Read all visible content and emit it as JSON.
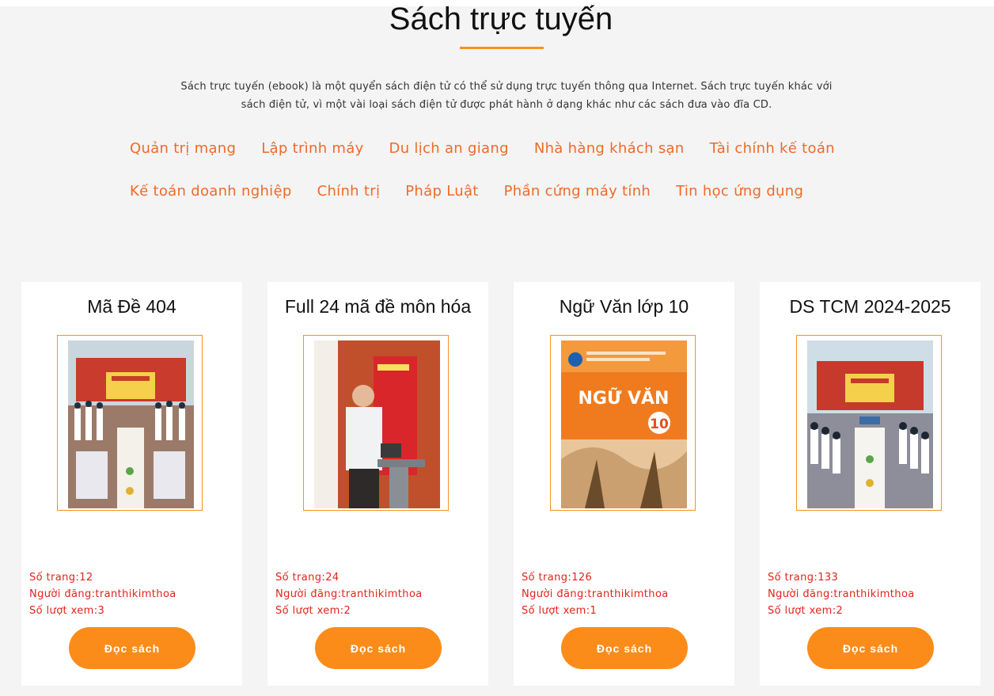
{
  "page": {
    "title": "Sách trực tuyến",
    "intro_line1": "Sách trực tuyến (ebook) là một quyển sách điện tử có thể sử dụng trực tuyến thông qua Internet. Sách trực tuyến khác với",
    "intro_line2": "sách điện tử, vì một vài loại sách điện tử được phát hành ở dạng khác như các sách đưa vào đĩa CD."
  },
  "categories_row1": [
    "Quản trị mạng",
    "Lập trình máy",
    "Du lịch an giang",
    "Nhà hàng khách sạn",
    "Tài chính kế toán"
  ],
  "categories_row2": [
    "Kế toán doanh nghiệp",
    "Chính trị",
    "Pháp Luật",
    "Phần cứng máy tính",
    "Tin học ứng dụng"
  ],
  "books": [
    {
      "title": "Mã Đề 404",
      "pages": "Số trang:12",
      "poster": "Người đăng:tranthikimthoa",
      "views": "Số lượt xem:3",
      "button": "Đọc sách"
    },
    {
      "title": "Full 24 mã đề môn hóa",
      "pages": "Số trang:24",
      "poster": "Người đăng:tranthikimthoa",
      "views": "Số lượt xem:2",
      "button": "Đọc sách"
    },
    {
      "title": "Ngữ Văn lớp 10",
      "pages": "Số trang:126",
      "poster": "Người đăng:tranthikimthoa",
      "views": "Số lượt xem:1",
      "button": "Đọc sách",
      "cover_text": "NGỮ VĂN",
      "cover_number": "10"
    },
    {
      "title": "DS TCM 2024-2025",
      "pages": "Số trang:133",
      "poster": "Người đăng:tranthikimthoa",
      "views": "Số lượt xem:2",
      "button": "Đọc sách"
    }
  ],
  "colors": {
    "accent": "#f7931e",
    "category": "#f06a28",
    "meta": "#e0241b",
    "button": "#fb8c1a"
  }
}
